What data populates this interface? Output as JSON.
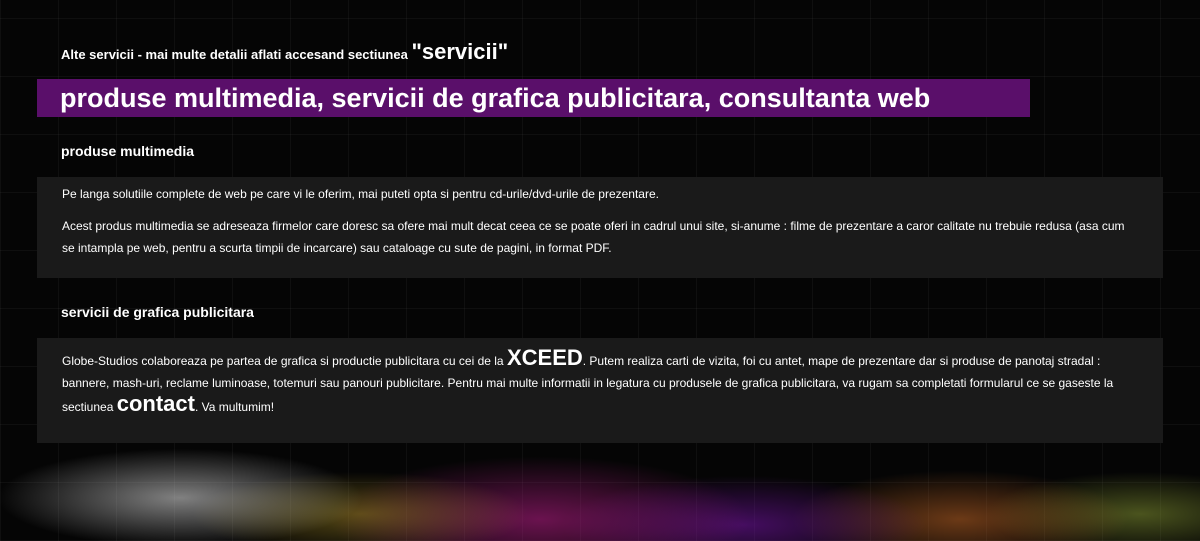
{
  "intro": {
    "text": "Alte servicii - mai multe detalii aflati accesand sectiunea",
    "link": "\"servicii\""
  },
  "banner": {
    "title": "produse multimedia, servicii de grafica publicitara, consultanta web"
  },
  "multimedia": {
    "title": "produse multimedia",
    "p1": "Pe langa solutiile complete de web pe care vi le oferim, mai puteti opta si pentru cd-urile/dvd-urile de prezentare.",
    "p2": "Acest produs multimedia se adreseaza firmelor care doresc sa ofere mai mult decat ceea ce se poate oferi in cadrul unui site, si-anume : filme de prezentare a caror calitate nu trebuie redusa (asa cum se intampla pe web, pentru a scurta timpii de incarcare) sau cataloage cu sute de pagini, in format PDF."
  },
  "grafica": {
    "title": "servicii de grafica publicitara",
    "text_a": "Globe-Studios colaboreaza pe partea de grafica si productie publicitara cu cei de la",
    "brand": "XCEED",
    "text_b": ". Putem realiza carti de vizita, foi cu antet, mape de prezentare dar si produse de panotaj stradal : bannere, mash-uri, reclame luminoase, totemuri sau panouri publicitare. Pentru mai multe informatii in legatura cu produsele de grafica publicitara, va rugam sa completati formularul ce se gaseste la sectiunea",
    "contact": "contact",
    "text_c": ". Va multumim!"
  },
  "colors": {
    "banner_bg": "#5a0f6a",
    "box_bg": "#1a1a1a",
    "page_bg": "#050505"
  }
}
